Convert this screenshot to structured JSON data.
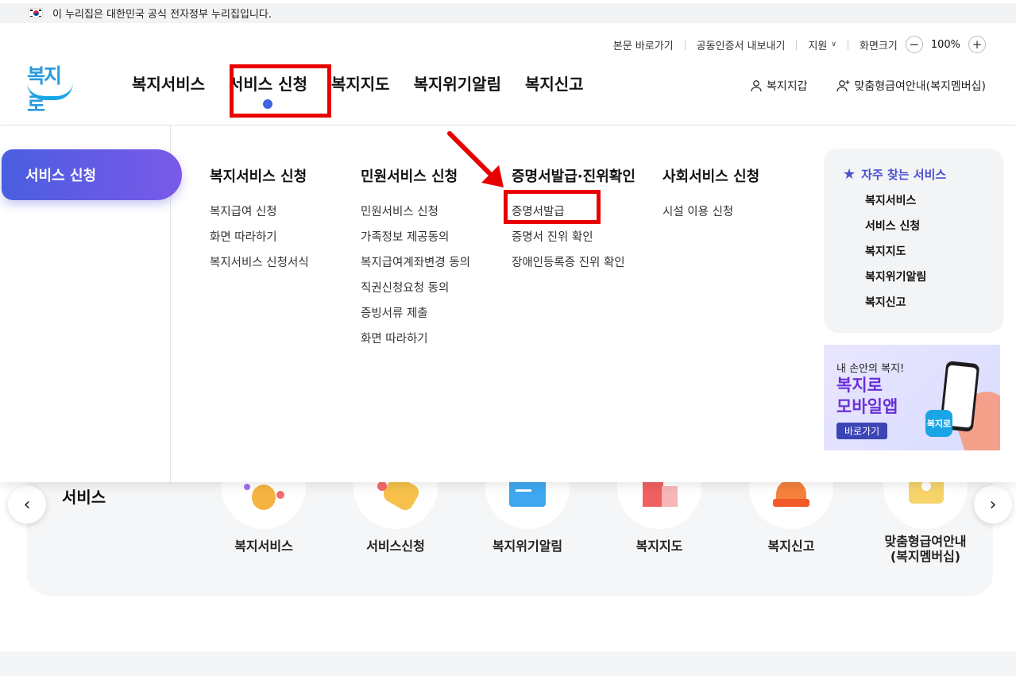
{
  "gov_banner": {
    "text": "이 누리집은 대한민국 공식 전자정부 누리집입니다."
  },
  "utility": {
    "skip": "본문 바로가기",
    "cert": "공동인증서 내보내기",
    "support": "지원",
    "screen_size": "화면크기",
    "zoom_minus": "−",
    "zoom_value": "100%",
    "zoom_plus": "+"
  },
  "logo": {
    "text": "복지로"
  },
  "gnb": [
    "복지서비스",
    "서비스 신청",
    "복지지도",
    "복지위기알림",
    "복지신고"
  ],
  "header_right": {
    "wallet": "복지지갑",
    "membership": "맞춤형급여안내(복지멤버십)"
  },
  "mega": {
    "side_label": "서비스 신청",
    "columns": [
      {
        "title": "복지서비스 신청",
        "items": [
          "복지급여 신청",
          "화면 따라하기",
          "복지서비스 신청서식"
        ]
      },
      {
        "title": "민원서비스 신청",
        "items": [
          "민원서비스 신청",
          "가족정보 제공동의",
          "복지급여계좌변경 동의",
          "직권신청요청 동의",
          "증빙서류 제출",
          "화면 따라하기"
        ]
      },
      {
        "title": "증명서발급·진위확인",
        "items": [
          "증명서발급",
          "증명서 진위 확인",
          "장애인등록증 진위 확인"
        ]
      },
      {
        "title": "사회서비스 신청",
        "items": [
          "시설 이용 신청"
        ]
      }
    ],
    "favorites": {
      "title": "자주 찾는 서비스",
      "items": [
        "복지서비스",
        "서비스 신청",
        "복지지도",
        "복지위기알림",
        "복지신고"
      ]
    },
    "banner": {
      "line1": "내 손안의 복지!",
      "line2a": "복지로",
      "line2b": "모바일앱",
      "button": "바로가기",
      "app_icon": "복지로"
    }
  },
  "services": {
    "title": "서비스",
    "items": [
      "복지서비스",
      "서비스신청",
      "복지위기알림",
      "복지지도",
      "복지신고",
      "맞춤형급여안내\n(복지멤버십)"
    ],
    "prev": "‹",
    "next": "›"
  },
  "colors": {
    "accent": "#3d63dd",
    "highlight_red": "#e80000",
    "pill_start": "#4a5ee0",
    "pill_end": "#7b59e9"
  },
  "icons": {
    "star": "star-icon",
    "person": "person-icon",
    "person_add": "person-add-icon",
    "chevron": "chevron-down-icon"
  }
}
